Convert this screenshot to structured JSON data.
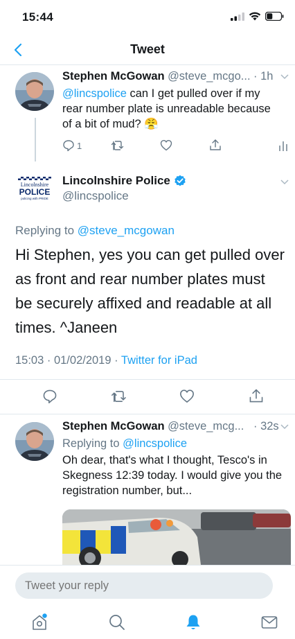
{
  "status": {
    "time": "15:44"
  },
  "nav": {
    "title": "Tweet"
  },
  "tweet1": {
    "name": "Stephen McGowan",
    "handle": "@steve_mcgo...",
    "time": "· 1h",
    "mention": "@lincspolice",
    "text_line1_rest": " can I get pulled over if my",
    "text_line2": "rear number plate is unreadable because",
    "text_line3": "of a bit of mud?",
    "emoji": "😤",
    "reply_count": "1"
  },
  "main": {
    "logo_line1": "Lincolnshire",
    "logo_line2": "POLICE",
    "logo_line3": "policing with PRIDE",
    "name": "Lincolnshire Police",
    "handle": "@lincspolice",
    "replying_label": "Replying to",
    "replying_handle": "@steve_mcgowan",
    "body": "Hi Stephen, yes you can get pulled over as front and rear number plates must be securely affixed and readable at all times. ^Janeen",
    "timestamp": "15:03 · 01/02/2019 ·",
    "source": "Twitter for iPad"
  },
  "tweet3": {
    "name": "Stephen McGowan",
    "handle": "@steve_mcg...",
    "time": "· 32s",
    "replying_label": "Replying to",
    "replying_handle": "@lincspolice",
    "body": "Oh dear, that's what I thought, Tesco's in Skegness 12:39 today. I would give you the registration number, but..."
  },
  "composer": {
    "placeholder": "Tweet your reply"
  },
  "tabbar": {
    "notification_dot": "#1da1f2",
    "active_color": "#1da1f2",
    "inactive_color": "#657786"
  },
  "colors": {
    "accent": "#1da1f2",
    "secondary_text": "#657786"
  }
}
